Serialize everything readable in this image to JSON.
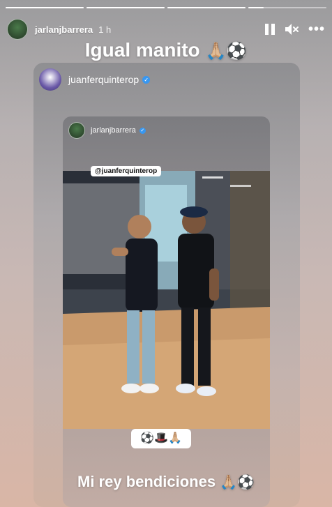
{
  "story": {
    "progress": [
      1,
      1,
      1,
      0.2
    ],
    "user": {
      "username": "jarlanjbarrera",
      "time": "1 h"
    },
    "caption_top": {
      "text": "Igual manito",
      "emoji": "🙏🏼⚽"
    },
    "caption_bottom": {
      "text": "Mi rey bendiciones",
      "emoji": "🙏🏼⚽"
    }
  },
  "shared_post": {
    "username": "juanferquinterop",
    "verified_glyph": "✓",
    "inner": {
      "username": "jarlanjbarrera",
      "verified_glyph": "✓",
      "mention_tag": "@juanferquinterop",
      "emoji_sticker": "⚽🎩🙏🏼"
    }
  },
  "icons": {
    "pause": "pause-icon",
    "mute": "speaker-muted-icon",
    "more": "more-icon"
  }
}
